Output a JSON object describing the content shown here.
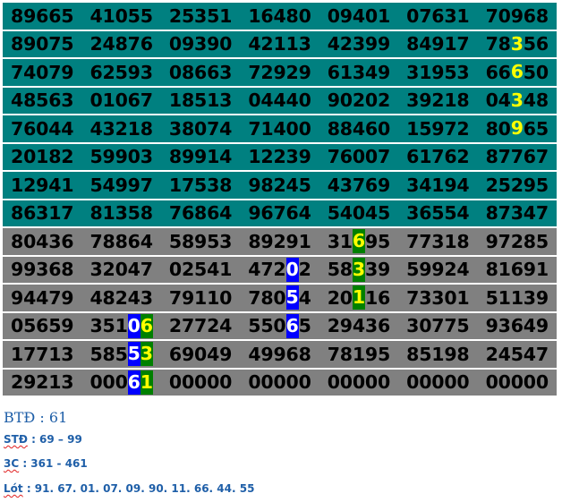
{
  "grid": {
    "colors": {
      "teal": "#008080",
      "gray": "#808080",
      "highlight_yellow": "#ffff00",
      "highlight_blue": "#0000ff",
      "highlight_green": "#008000"
    },
    "rows": [
      {
        "color": "teal",
        "cells": [
          "89665",
          "41055",
          "25351",
          "16480",
          "09401",
          "07631",
          "70968"
        ]
      },
      {
        "color": "teal",
        "cells": [
          "89075",
          "24876",
          "09390",
          "42113",
          "42399",
          "84917",
          [
            {
              "t": "78"
            },
            {
              "t": "3",
              "s": "yellow"
            },
            {
              "t": "56"
            }
          ]
        ]
      },
      {
        "color": "teal",
        "cells": [
          "74079",
          "62593",
          "08663",
          "72929",
          "61349",
          "31953",
          [
            {
              "t": "66"
            },
            {
              "t": "6",
              "s": "yellow"
            },
            {
              "t": "50"
            }
          ]
        ]
      },
      {
        "color": "teal",
        "cells": [
          "48563",
          "01067",
          "18513",
          "04440",
          "90202",
          "39218",
          [
            {
              "t": "04"
            },
            {
              "t": "3",
              "s": "yellow"
            },
            {
              "t": "48"
            }
          ]
        ]
      },
      {
        "color": "teal",
        "cells": [
          "76044",
          "43218",
          "38074",
          "71400",
          "88460",
          "15972",
          [
            {
              "t": "80"
            },
            {
              "t": "9",
              "s": "yellow"
            },
            {
              "t": "65"
            }
          ]
        ]
      },
      {
        "color": "teal",
        "cells": [
          "20182",
          "59903",
          "89914",
          "12239",
          "76007",
          "61762",
          "87767"
        ]
      },
      {
        "color": "teal",
        "cells": [
          "12941",
          "54997",
          "17538",
          "98245",
          "43769",
          "34194",
          "25295"
        ]
      },
      {
        "color": "teal",
        "cells": [
          "86317",
          "81358",
          "76864",
          "96764",
          "54045",
          "36554",
          "87347"
        ]
      },
      {
        "color": "gray",
        "cells": [
          "80436",
          "78864",
          "58953",
          "89291",
          [
            {
              "t": "31"
            },
            {
              "t": "6",
              "s": "green"
            },
            {
              "t": "95"
            }
          ],
          "77318",
          "97285"
        ]
      },
      {
        "color": "gray",
        "cells": [
          "99368",
          "32047",
          "02541",
          [
            {
              "t": "472"
            },
            {
              "t": "0",
              "s": "blue"
            },
            {
              "t": "2"
            }
          ],
          [
            {
              "t": "58"
            },
            {
              "t": "3",
              "s": "green"
            },
            {
              "t": "39"
            }
          ],
          "59924",
          "81691"
        ]
      },
      {
        "color": "gray",
        "cells": [
          "94479",
          "48243",
          "79110",
          [
            {
              "t": "780"
            },
            {
              "t": "5",
              "s": "blue"
            },
            {
              "t": "4"
            }
          ],
          [
            {
              "t": "20"
            },
            {
              "t": "1",
              "s": "green"
            },
            {
              "t": "16"
            }
          ],
          "73301",
          "51139"
        ]
      },
      {
        "color": "gray",
        "cells": [
          "05659",
          [
            {
              "t": "351"
            },
            {
              "t": "0",
              "s": "blue"
            },
            {
              "t": "6",
              "s": "green"
            }
          ],
          "27724",
          [
            {
              "t": "550"
            },
            {
              "t": "6",
              "s": "blue"
            },
            {
              "t": "5"
            }
          ],
          "29436",
          "30775",
          "93649"
        ]
      },
      {
        "color": "gray",
        "cells": [
          "17713",
          [
            {
              "t": "585"
            },
            {
              "t": "5",
              "s": "blue"
            },
            {
              "t": "3",
              "s": "green"
            }
          ],
          "69049",
          "49968",
          "78195",
          "85198",
          "24547"
        ]
      },
      {
        "color": "gray",
        "cells": [
          "29213",
          [
            {
              "t": "000"
            },
            {
              "t": "6",
              "s": "blue"
            },
            {
              "t": "1",
              "s": "green"
            }
          ],
          "00000",
          "00000",
          "00000",
          "00000",
          "00000"
        ]
      }
    ]
  },
  "notes": {
    "btd": {
      "label": "BTĐ",
      "value": " : 61"
    },
    "std": {
      "label": "STĐ",
      "value": " : 69 – 99"
    },
    "bc": {
      "label": "3C",
      "value": " : 361 - 461"
    },
    "lot": {
      "label": "Lót",
      "value": " : 91. 67. 01. 07. 09. 90. 11. 66. 44. 55"
    }
  }
}
